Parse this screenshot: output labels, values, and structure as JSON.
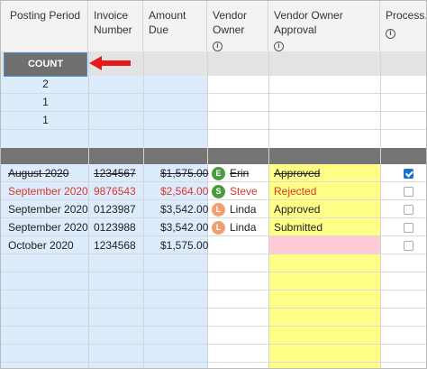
{
  "columns": [
    {
      "label": "Posting Period",
      "info": false
    },
    {
      "label": "Invoice Number",
      "info": false
    },
    {
      "label": "Amount Due",
      "info": false
    },
    {
      "label": "Vendor Owner",
      "info": true
    },
    {
      "label": "Vendor Owner Approval",
      "info": true
    },
    {
      "label": "Process.",
      "info": true
    }
  ],
  "summary": {
    "count_label": "COUNT",
    "counts": [
      "2",
      "1",
      "1"
    ]
  },
  "rows": [
    {
      "period": "August 2020",
      "invoice": "1234567",
      "amount": "$1,575.00",
      "owner_initial": "E",
      "owner": "Erin",
      "owner_color": "#4a9a3f",
      "approval": "Approved",
      "approval_bg": "#ffff88",
      "processed": true,
      "strike": true,
      "red": false
    },
    {
      "period": "September 2020",
      "invoice": "9876543",
      "amount": "$2,564.00",
      "owner_initial": "S",
      "owner": "Steve",
      "owner_color": "#4a9a3f",
      "approval": "Rejected",
      "approval_bg": "#ffff88",
      "processed": false,
      "strike": false,
      "red": true
    },
    {
      "period": "September 2020",
      "invoice": "0123987",
      "amount": "$3,542.00",
      "owner_initial": "L",
      "owner": "Linda",
      "owner_color": "#f0a070",
      "approval": "Approved",
      "approval_bg": "#ffff88",
      "processed": false,
      "strike": false,
      "red": false
    },
    {
      "period": "September 2020",
      "invoice": "0123988",
      "amount": "$3,542.00",
      "owner_initial": "L",
      "owner": "Linda",
      "owner_color": "#f0a070",
      "approval": "Submitted",
      "approval_bg": "#ffff88",
      "processed": false,
      "strike": false,
      "red": false
    },
    {
      "period": "October 2020",
      "invoice": "1234568",
      "amount": "$1,575.00",
      "owner_initial": "",
      "owner": "",
      "owner_color": "",
      "approval": "",
      "approval_bg": "#ffccd5",
      "processed": false,
      "strike": false,
      "red": false
    }
  ],
  "colors": {
    "header_bg": "#f3f3f3",
    "selected_column_bg": "#dcecfc",
    "approval_column_bg": "#ffff88",
    "group_band": "#757575",
    "arrow": "#e31b1b",
    "red_text": "#d9362b"
  },
  "icons": {
    "info": "info-circle-icon",
    "arrow": "red-arrow-left-icon",
    "checkbox": "checkbox-icon"
  }
}
